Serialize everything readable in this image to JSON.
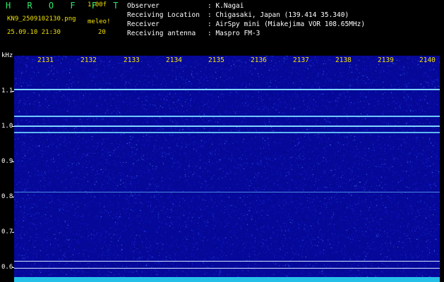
{
  "header": {
    "title": "H R O F F T",
    "version": "1.00f",
    "filename": "KN9_2509102130.png",
    "meteor_label": "meleo!",
    "datetime": "25.09.10 21:30",
    "count": "20"
  },
  "info": [
    {
      "key": "Observer",
      "value": ": K.Nagai"
    },
    {
      "key": "Receiving Location",
      "value": ": Chigasaki, Japan (139.414 35.340)"
    },
    {
      "key": "Receiver",
      "value": ": AirSpy mini (Miakejima VOR 108.65MHz)"
    },
    {
      "key": "Receiving antenna",
      "value": ": Maspro FM-3"
    }
  ],
  "yaxis": {
    "unit": "kHz",
    "ticks": [
      "1.1",
      "1.0",
      "0.9",
      "0.8",
      "0.7",
      "0.6"
    ]
  },
  "xaxis": {
    "ticks": [
      "2131",
      "2132",
      "2133",
      "2134",
      "2135",
      "2136",
      "2137",
      "2138",
      "2139",
      "2140"
    ]
  },
  "colors": {
    "background": "#000000",
    "spectrogram": "#06089a",
    "signal": "#6fd0ff",
    "labels": "#f4e300",
    "title": "#2ee86a"
  }
}
